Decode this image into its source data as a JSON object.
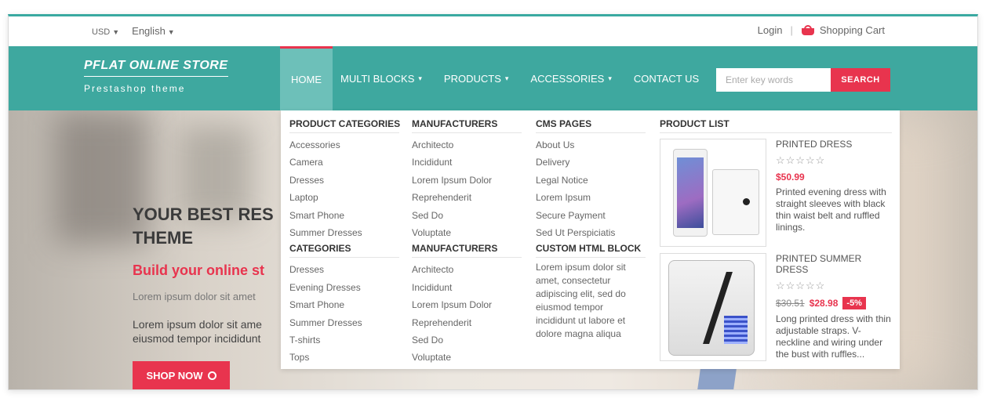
{
  "topbar": {
    "currency": "USD",
    "language": "English",
    "login": "Login",
    "separator": "|",
    "cart": "Shopping Cart"
  },
  "logo": {
    "name": "PFLAT ONLINE STORE",
    "tagline": "Prestashop theme"
  },
  "nav": {
    "items": [
      {
        "label": "HOME"
      },
      {
        "label": "MULTI BLOCKS"
      },
      {
        "label": "PRODUCTS"
      },
      {
        "label": "ACCESSORIES"
      },
      {
        "label": "CONTACT US"
      }
    ]
  },
  "search": {
    "placeholder": "Enter key words",
    "button": "SEARCH"
  },
  "hero": {
    "title": "YOUR BEST RES THEME",
    "subtitle": "Build your online st",
    "lorem1": "Lorem ipsum dolor sit amet",
    "lorem2": "Lorem ipsum dolor sit ame eiusmod tempor incididunt",
    "button": "SHOP NOW"
  },
  "mega": {
    "product_categories": {
      "head": "PRODUCT CATEGORIES",
      "links": [
        "Accessories",
        "Camera",
        "Dresses",
        "Laptop",
        "Smart Phone",
        "Summer Dresses"
      ]
    },
    "categories": {
      "head": "CATEGORIES",
      "links": [
        "Dresses",
        "Evening Dresses",
        "Smart Phone",
        "Summer Dresses",
        "T-shirts",
        "Tops"
      ]
    },
    "manufacturers_1": {
      "head": "MANUFACTURERS",
      "links": [
        "Architecto",
        "Incididunt",
        "Lorem Ipsum Dolor",
        "Reprehenderit",
        "Sed Do",
        "Voluptate"
      ]
    },
    "manufacturers_2": {
      "head": "MANUFACTURERS",
      "links": [
        "Architecto",
        "Incididunt",
        "Lorem Ipsum Dolor",
        "Reprehenderit",
        "Sed Do",
        "Voluptate"
      ]
    },
    "cms_pages": {
      "head": "CMS PAGES",
      "links": [
        "About Us",
        "Delivery",
        "Legal Notice",
        "Lorem Ipsum",
        "Secure Payment",
        "Sed Ut Perspiciatis"
      ]
    },
    "custom_html": {
      "head": "CUSTOM HTML BLOCK",
      "text": "Lorem ipsum dolor sit amet, consectetur adipiscing elit, sed do eiusmod tempor incididunt ut labore et dolore magna aliqua"
    },
    "product_list": {
      "head": "PRODUCT LIST",
      "products": [
        {
          "name": "PRINTED DRESS",
          "stars": "☆☆☆☆☆",
          "price": "$50.99",
          "old_price": "",
          "discount": "",
          "desc": "Printed evening dress with straight sleeves with black thin waist belt and ruffled linings."
        },
        {
          "name": "PRINTED SUMMER DRESS",
          "stars": "☆☆☆☆☆",
          "price": "$28.98",
          "old_price": "$30.51",
          "discount": "-5%",
          "desc": "Long printed dress with thin adjustable straps. V-neckline and wiring under the bust with ruffles..."
        }
      ]
    }
  },
  "colors": {
    "teal": "#3ea89f",
    "teal_active": "#6dc0b9",
    "accent": "#e8344e"
  }
}
